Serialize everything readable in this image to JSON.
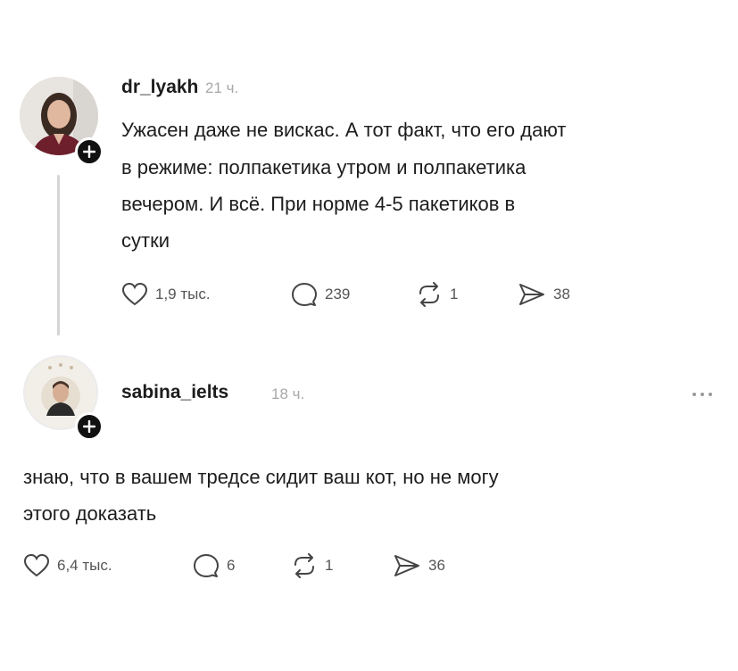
{
  "posts": [
    {
      "username": "dr_lyakh",
      "time": "21 ч.",
      "text_lines": [
        "Ужасен даже не вискас. А тот факт, что его дают",
        "в режиме: полпакетика утром и полпакетика",
        "вечером. И всё.  При норме 4-5 пакетиков в",
        "сутки"
      ],
      "likes": "1,9 тыс.",
      "replies": "239",
      "reposts": "1",
      "shares": "38"
    },
    {
      "username": "sabina_ielts",
      "time": "18 ч.",
      "text_lines": [
        "знаю, что в вашем тредсе сидит ваш кот, но не могу",
        "этого доказать"
      ],
      "likes": "6,4 тыс.",
      "replies": "6",
      "reposts": "1",
      "shares": "36"
    }
  ],
  "icons": {
    "like": "heart-icon",
    "reply": "comment-icon",
    "repost": "repost-icon",
    "share": "send-icon",
    "follow": "plus-icon",
    "more": "more-icon"
  },
  "colors": {
    "text": "#1d1d1d",
    "muted": "#a8a8a8",
    "icon": "#555555",
    "badge": "#111111",
    "thread_line": "#d4d4d4"
  }
}
